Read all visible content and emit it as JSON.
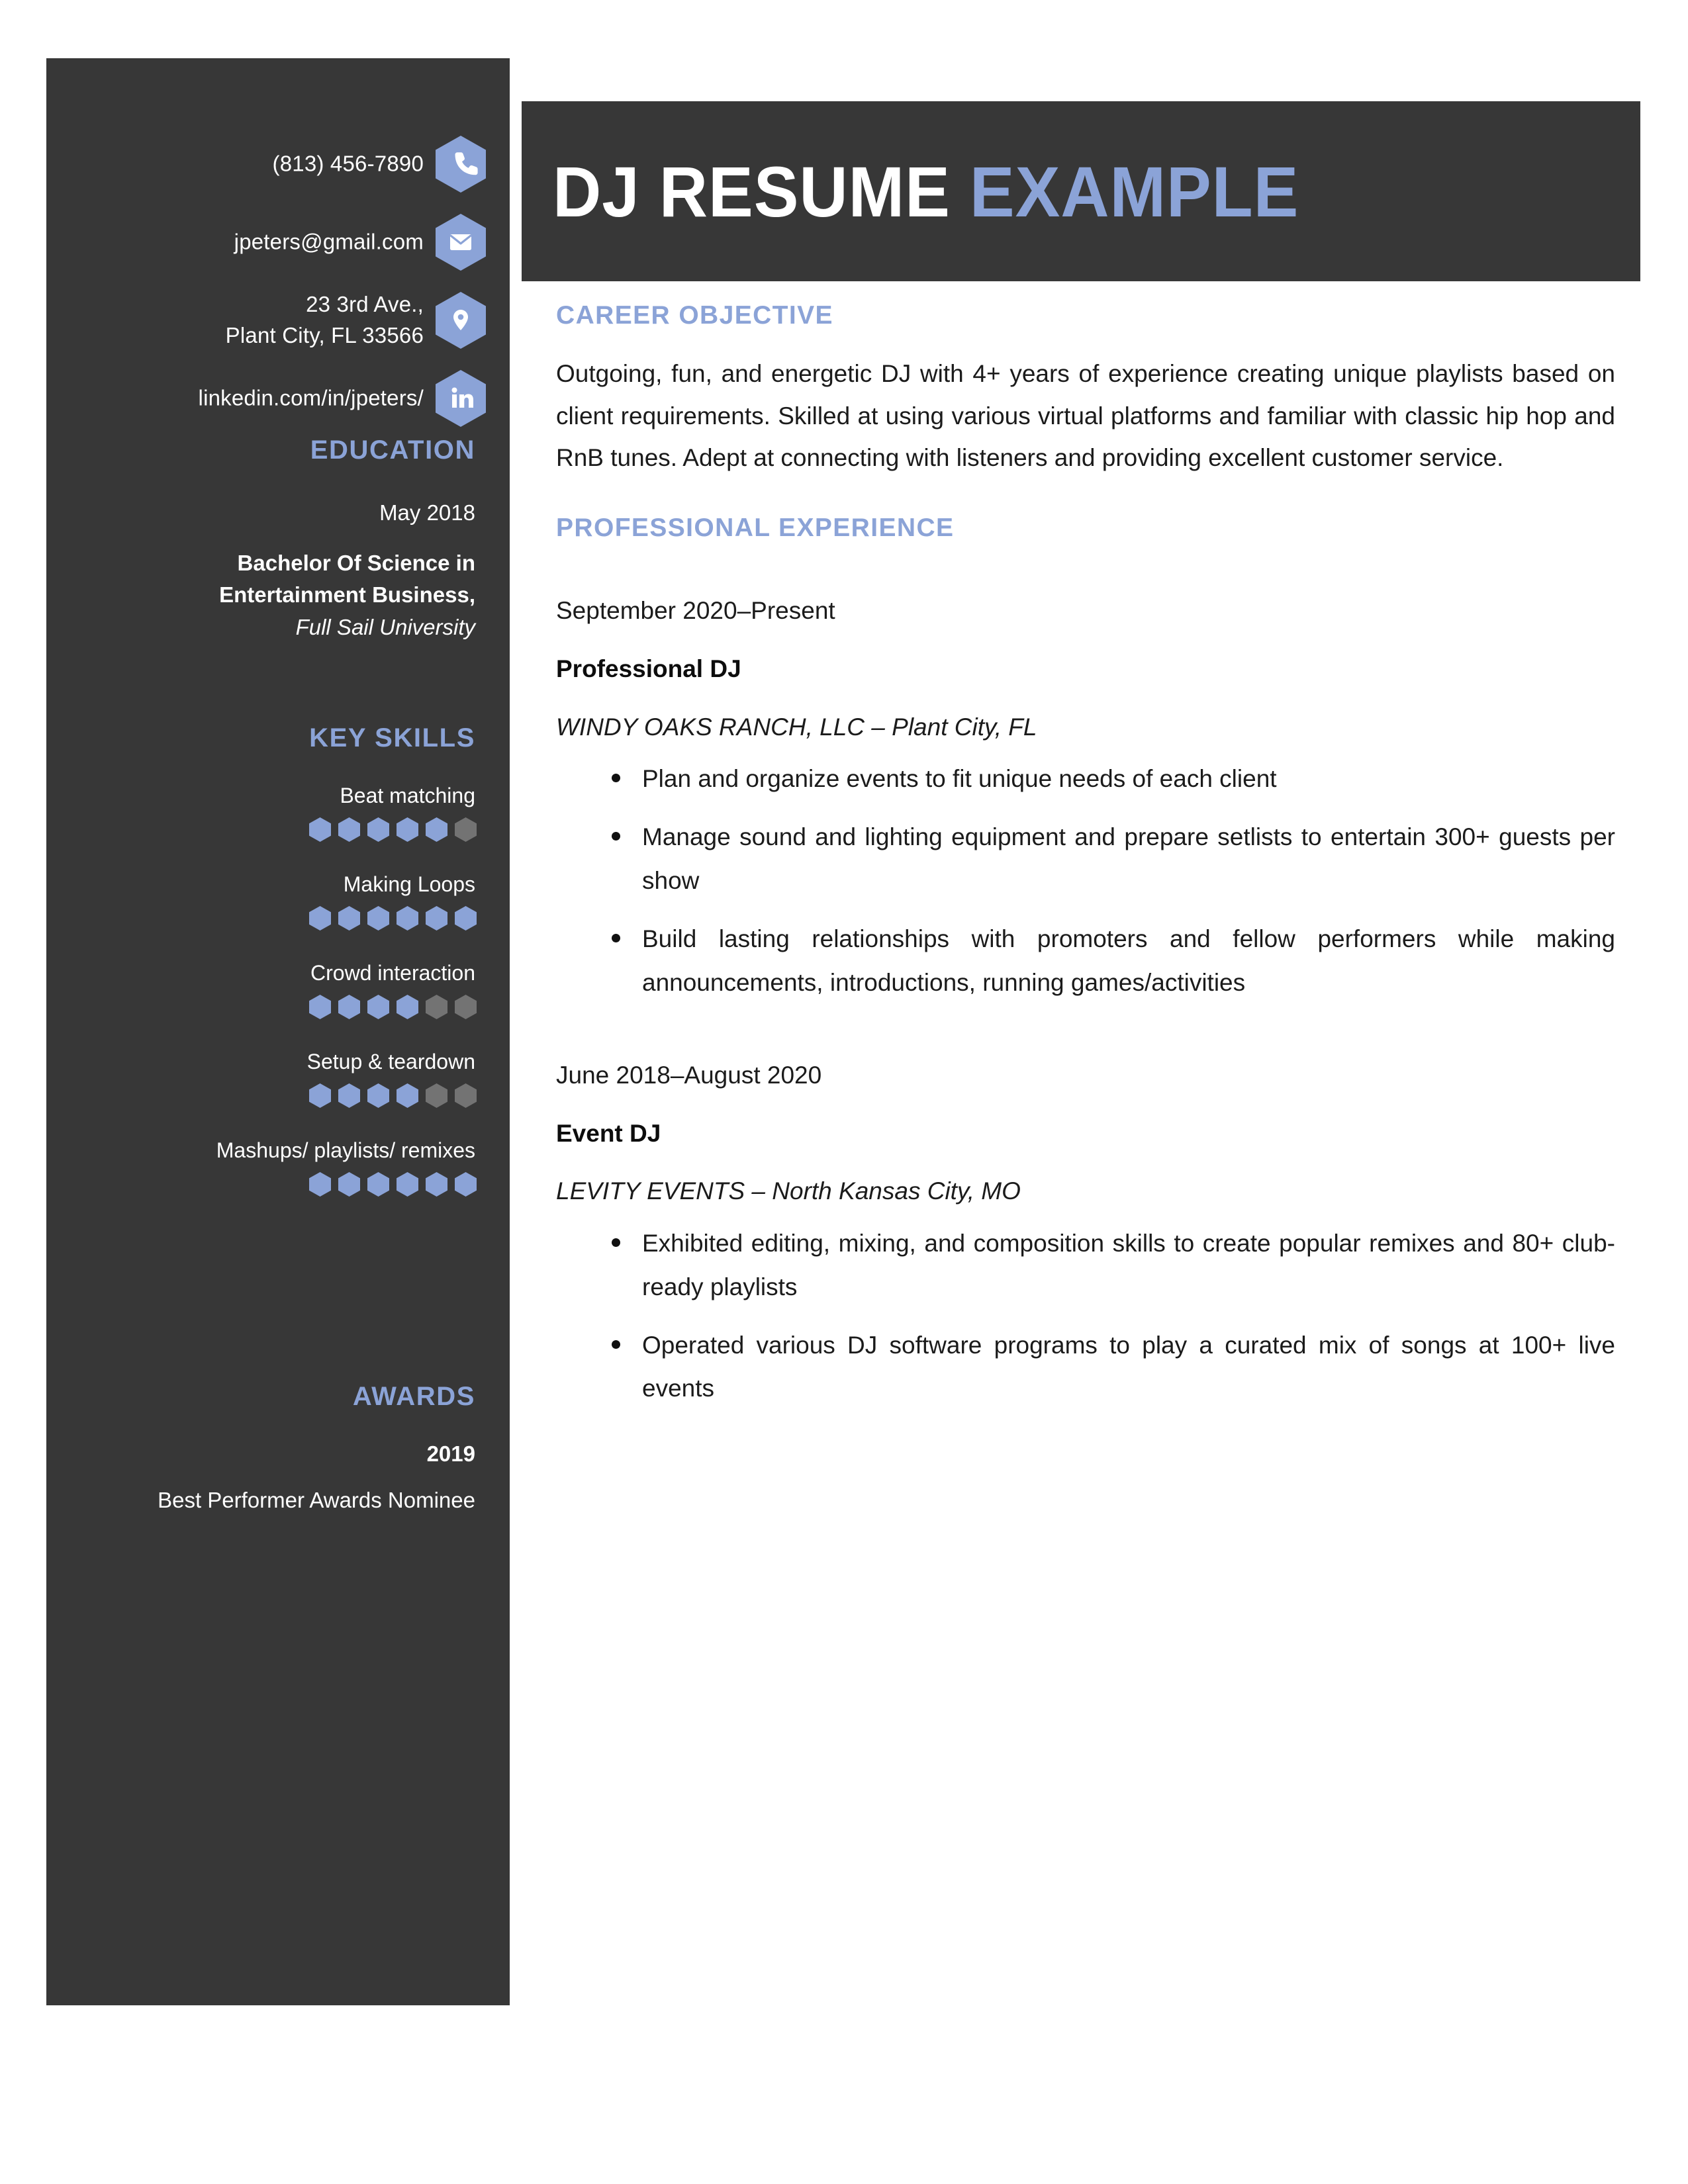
{
  "colors": {
    "accent_blue": "#8BA3D7",
    "dark_panel": "#373737",
    "inactive_gray": "#737373",
    "text_dark": "#1b1b1b",
    "page_bg": "#ffffff"
  },
  "header": {
    "title_part1": "DJ RESUME ",
    "title_part2": "EXAMPLE"
  },
  "sidebar": {
    "contacts": [
      {
        "icon": "phone-icon",
        "text": "(813) 456-7890"
      },
      {
        "icon": "envelope-icon",
        "text": "jpeters@gmail.com"
      },
      {
        "icon": "map-pin-icon",
        "text": "23 3rd Ave.,\nPlant City, FL 33566"
      },
      {
        "icon": "linkedin-icon",
        "text": "linkedin.com/in/jpeters/"
      }
    ],
    "education": {
      "heading": "EDUCATION",
      "date": "May 2018",
      "degree_line1": "Bachelor Of Science in",
      "degree_line2": "Entertainment Business,",
      "school": "Full Sail University"
    },
    "key_skills": {
      "heading": "KEY SKILLS",
      "max_rating": 6,
      "items": [
        {
          "label": "Beat matching",
          "rating": 5
        },
        {
          "label": "Making Loops",
          "rating": 6
        },
        {
          "label": "Crowd interaction",
          "rating": 4
        },
        {
          "label": "Setup & teardown",
          "rating": 4
        },
        {
          "label": "Mashups/ playlists/ remixes",
          "rating": 6
        }
      ]
    },
    "awards": {
      "heading": "AWARDS",
      "year": "2019",
      "title": "Best Performer Awards Nominee"
    }
  },
  "main": {
    "career_objective": {
      "heading": "CAREER OBJECTIVE",
      "body": "Outgoing, fun, and energetic DJ with 4+ years of experience creating unique playlists based on client requirements. Skilled at using various virtual platforms and familiar with classic hip hop and RnB tunes. Adept at connecting with listeners and providing excellent customer service."
    },
    "professional_experience": {
      "heading": "PROFESSIONAL EXPERIENCE",
      "jobs": [
        {
          "date": "September 2020–Present",
          "title": "Professional DJ",
          "company": "WINDY OAKS RANCH, LLC – Plant City, FL",
          "bullets": [
            "Plan and organize events to fit unique needs of each client",
            "Manage sound and lighting equipment and prepare setlists to entertain 300+ guests per show",
            "Build lasting relationships with promoters and fellow performers while making announcements, introductions, running games/activities"
          ]
        },
        {
          "date": "June 2018–August 2020",
          "title": "Event DJ",
          "company": "LEVITY EVENTS – North Kansas City, MO",
          "bullets": [
            "Exhibited editing, mixing, and composition skills to create popular remixes and 80+ club-ready playlists",
            "Operated various DJ software programs to play a curated mix of songs at 100+ live events"
          ]
        }
      ]
    }
  }
}
